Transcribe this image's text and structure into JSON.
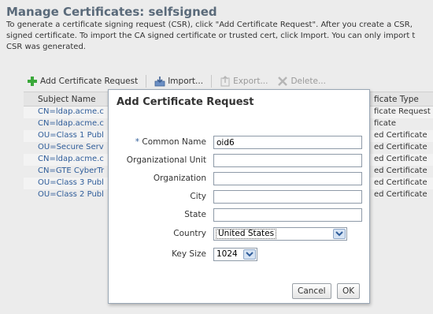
{
  "page": {
    "title": "Manage Certificates: selfsigned",
    "description": "To generate a certificate signing request (CSR), click \"Add Certificate Request\". After you create a CSR,\nsigned certificate. To import the CA signed certificate or trusted cert, click Import. You can only import t\nCSR was generated."
  },
  "toolbar": {
    "add_label": "Add Certificate Request",
    "import_label": "Import...",
    "export_label": "Export...",
    "delete_label": "Delete..."
  },
  "table": {
    "headers": {
      "subject": "Subject Name",
      "type": "ficate Type"
    },
    "rows": [
      {
        "subject": "CN=ldap.acme.c",
        "type": "ficate Request"
      },
      {
        "subject": "CN=ldap.acme.c",
        "type": "ficate"
      },
      {
        "subject": "OU=Class 1 Publ",
        "type": "ed Certificate"
      },
      {
        "subject": "OU=Secure Serv",
        "type": "ed Certificate"
      },
      {
        "subject": "CN=ldap.acme.c",
        "type": "ed Certificate"
      },
      {
        "subject": "CN=GTE CyberTr",
        "type": "ed Certificate"
      },
      {
        "subject": "OU=Class 3 Publ",
        "type": "ed Certificate"
      },
      {
        "subject": "OU=Class 2 Publ",
        "type": "ed Certificate"
      }
    ]
  },
  "dialog": {
    "title": "Add Certificate Request",
    "required_mark": "*",
    "fields": {
      "common_name": {
        "label": "Common Name",
        "value": "oid6"
      },
      "org_unit": {
        "label": "Organizational Unit",
        "value": ""
      },
      "organization": {
        "label": "Organization",
        "value": ""
      },
      "city": {
        "label": "City",
        "value": ""
      },
      "state": {
        "label": "State",
        "value": ""
      },
      "country": {
        "label": "Country",
        "value": "United States"
      },
      "key_size": {
        "label": "Key Size",
        "value": "1024"
      }
    },
    "cancel_label": "Cancel",
    "ok_label": "OK"
  },
  "colors": {
    "link": "#2f5d9a",
    "title": "#5a6a7a",
    "add_icon": "#3aa83a"
  }
}
